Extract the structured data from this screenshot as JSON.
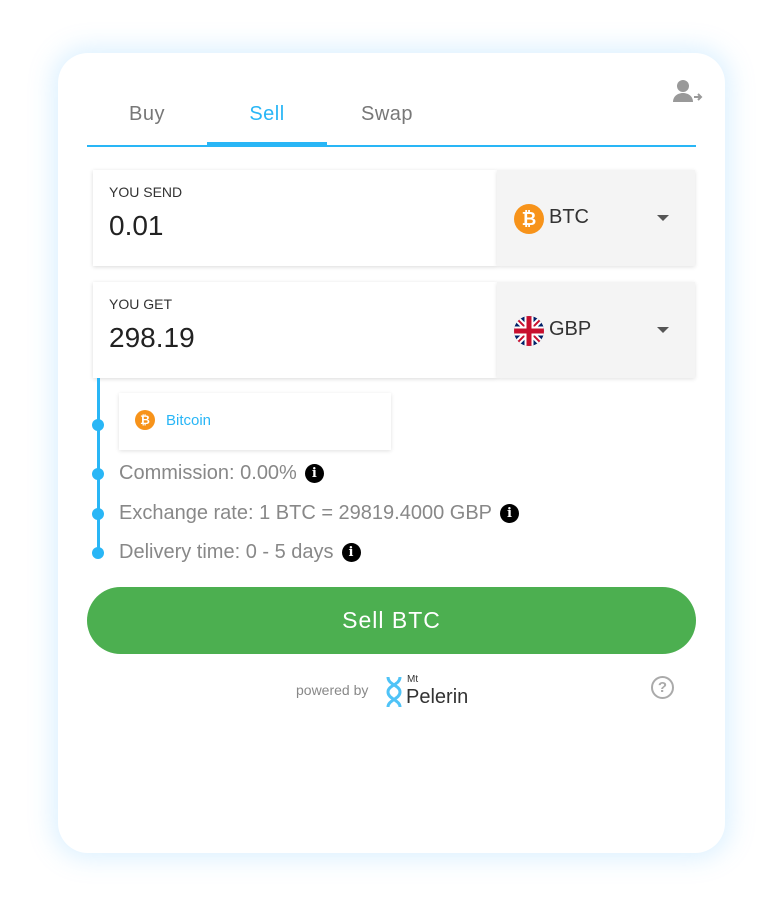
{
  "tabs": [
    {
      "label": "Buy"
    },
    {
      "label": "Sell",
      "active": true
    },
    {
      "label": "Swap"
    }
  ],
  "send": {
    "label": "YOU SEND",
    "value": "0.01",
    "currency": "BTC"
  },
  "get": {
    "label": "YOU GET",
    "value": "298.19",
    "currency": "GBP"
  },
  "network": {
    "label": "Bitcoin"
  },
  "details": {
    "commission": "Commission: 0.00%",
    "exchange_rate": "Exchange rate: 1 BTC = 29819.4000 GBP",
    "delivery": "Delivery time: 0 - 5 days"
  },
  "action": {
    "label": "Sell BTC"
  },
  "footer": {
    "powered_by": "powered by",
    "logo_small": "Mt",
    "logo_main": "Pelerin"
  },
  "colors": {
    "accent": "#29b6f6",
    "button": "#4caf50",
    "bitcoin": "#f7931a"
  }
}
